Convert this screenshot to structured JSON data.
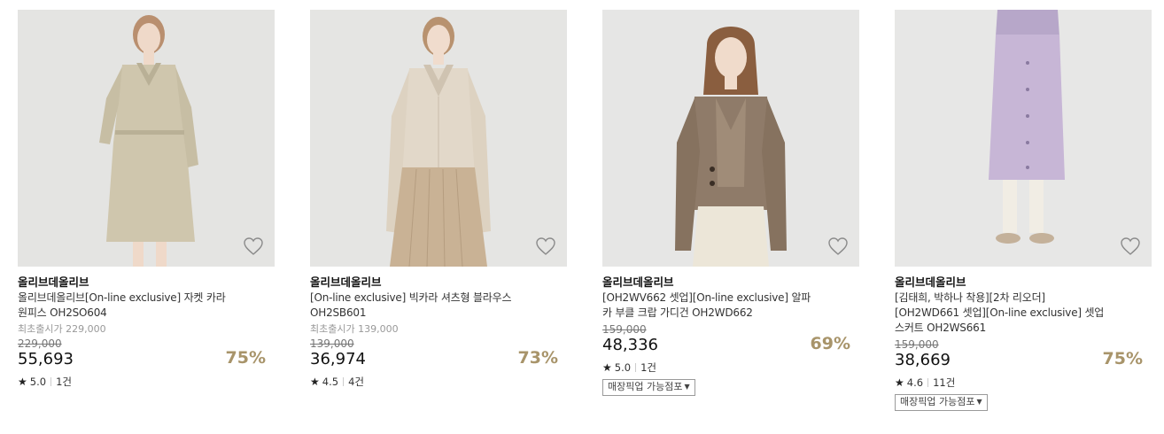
{
  "products": [
    {
      "brand": "올리브데올리브",
      "name_line1": "올리브데올리브[On-line exclusive] 자켓 카라",
      "name_line2": "원피스 OH2SO604",
      "name_line3": "",
      "launch_price_label": "최초출시가 229,000",
      "original_price": "229,000",
      "price": "55,693",
      "discount": "75%",
      "rating": "5.0",
      "review_count": "1건",
      "pickup_label": "",
      "image_desc": "model-beige-dress",
      "colors": {
        "bg": "#e4e4e2",
        "garment": "#cfc6ad",
        "garment_dark": "#b9b096"
      }
    },
    {
      "brand": "올리브데올리브",
      "name_line1": "[On-line exclusive] 빅카라 셔츠형 블라우스",
      "name_line2": "OH2SB601",
      "name_line3": "",
      "launch_price_label": "최초출시가 139,000",
      "original_price": "139,000",
      "price": "36,974",
      "discount": "73%",
      "rating": "4.5",
      "review_count": "4건",
      "pickup_label": "",
      "image_desc": "model-shirt-pleated-skirt",
      "colors": {
        "bg": "#e5e5e3",
        "garment": "#e2d8c9",
        "garment_dark": "#c9b295"
      }
    },
    {
      "brand": "올리브데올리브",
      "name_line1": "[OH2WV662 셋업][On-line exclusive] 알파",
      "name_line2": "카 부클 크랍 가디건 OH2WD662",
      "name_line3": "",
      "launch_price_label": "",
      "original_price": "159,000",
      "price": "48,336",
      "discount": "69%",
      "rating": "5.0",
      "review_count": "1건",
      "pickup_label": "매장픽업 가능점포",
      "image_desc": "model-brown-cardigan",
      "colors": {
        "bg": "#e6e6e5",
        "garment": "#8f7b69",
        "garment_dark": "#6f5e50"
      }
    },
    {
      "brand": "올리브데올리브",
      "name_line1": "[김태희, 박하나 착용][2차 리오더]",
      "name_line2": "[OH2WD661 셋업][On-line exclusive] 셋업",
      "name_line3": "스커트 OH2WS661",
      "launch_price_label": "",
      "original_price": "159,000",
      "price": "38,669",
      "discount": "75%",
      "rating": "4.6",
      "review_count": "11건",
      "pickup_label": "매장픽업 가능점포",
      "image_desc": "model-lilac-skirt",
      "colors": {
        "bg": "#e7e7e6",
        "garment": "#c7b6d6",
        "garment_dark": "#ab98bf"
      }
    }
  ]
}
